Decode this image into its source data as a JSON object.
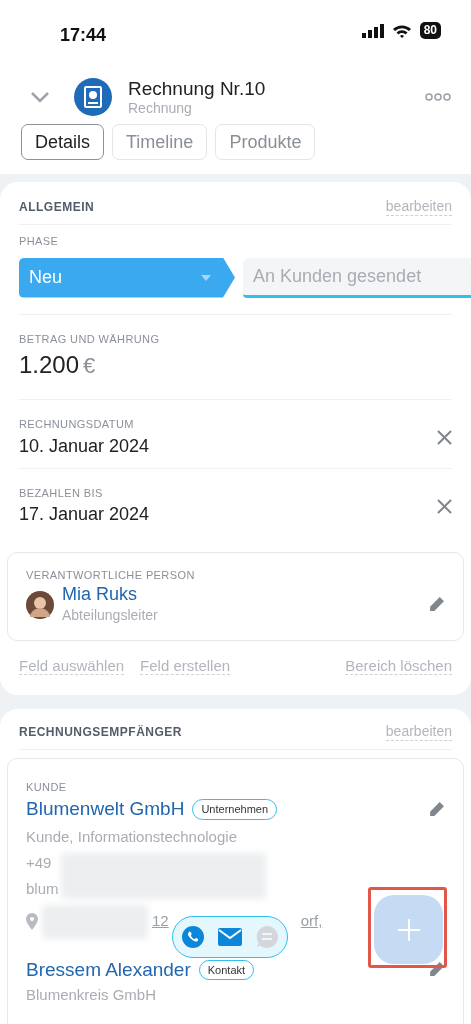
{
  "status_bar": {
    "time": "17:44",
    "battery": "80"
  },
  "header": {
    "title": "Rechnung Nr.10",
    "subtitle": "Rechnung"
  },
  "tabs": [
    {
      "label": "Details",
      "selected": true
    },
    {
      "label": "Timeline",
      "selected": false
    },
    {
      "label": "Produkte",
      "selected": false
    }
  ],
  "general": {
    "title": "ALLGEMEIN",
    "edit": "bearbeiten",
    "phase_label": "PHASE",
    "stages": [
      {
        "label": "Neu",
        "selected": true
      },
      {
        "label": "An Kunden gesendet",
        "selected": false
      }
    ],
    "amount": {
      "label": "BETRAG UND WÄHRUNG",
      "value": "1.200",
      "currency": "€"
    },
    "dates": [
      {
        "label": "RECHNUNGSDATUM",
        "value": "10. Januar 2024"
      },
      {
        "label": "BEZAHLEN BIS",
        "value": "17. Januar 2024"
      }
    ],
    "responsible": {
      "label": "VERANTWORTLICHE PERSON",
      "name": "Mia Ruks",
      "position": "Abteilungsleiter"
    },
    "actions": [
      "Feld auswählen",
      "Feld erstellen"
    ],
    "delete": "Bereich löschen"
  },
  "recipients": {
    "title": "RECHNUNGSEMPFÄNGER",
    "edit": "bearbeiten",
    "client_label": "KUNDE",
    "company": {
      "name": "Blumenwelt GmbH",
      "tag": "Unternehmen",
      "details": "Kunde, Informationstechnologie",
      "phone": "+49",
      "email": "blum",
      "address_start": "12",
      "address_end": "orf,"
    },
    "contact": {
      "name": "Bressem Alexander",
      "tag": "Kontakt",
      "company": "Blumenkreis GmbH"
    }
  }
}
